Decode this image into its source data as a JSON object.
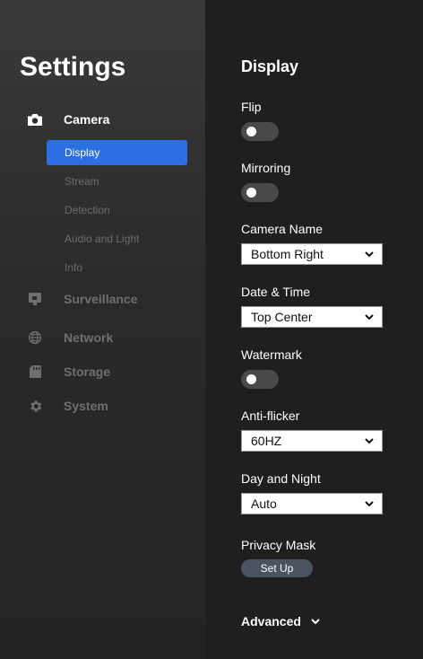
{
  "app": {
    "title": "Settings"
  },
  "sidebar": {
    "camera": {
      "label": "Camera",
      "icon": "camera-icon"
    },
    "sub_items": [
      {
        "label": "Display",
        "active": true
      },
      {
        "label": "Stream",
        "active": false
      },
      {
        "label": "Detection",
        "active": false
      },
      {
        "label": "Audio and Light",
        "active": false
      },
      {
        "label": "Info",
        "active": false
      }
    ],
    "surveillance": {
      "label": "Surveillance",
      "icon": "surveillance-icon"
    },
    "network": {
      "label": "Network",
      "icon": "globe-icon"
    },
    "storage": {
      "label": "Storage",
      "icon": "sd-card-icon"
    },
    "system": {
      "label": "System",
      "icon": "gear-icon"
    }
  },
  "display": {
    "title": "Display",
    "flip": {
      "label": "Flip",
      "on": false
    },
    "mirroring": {
      "label": "Mirroring",
      "on": false
    },
    "camera_name": {
      "label": "Camera Name",
      "value": "Bottom Right"
    },
    "date_time": {
      "label": "Date & Time",
      "value": "Top Center"
    },
    "watermark": {
      "label": "Watermark",
      "on": false
    },
    "anti_flicker": {
      "label": "Anti-flicker",
      "value": "60HZ"
    },
    "day_night": {
      "label": "Day and Night",
      "value": "Auto"
    },
    "privacy_mask": {
      "label": "Privacy Mask",
      "button": "Set Up"
    },
    "advanced": {
      "label": "Advanced"
    }
  },
  "colors": {
    "accent": "#2b6fe3",
    "sidebar_bg": "#2a2a2a",
    "content_bg": "#1f1f1f",
    "toggle_off": "#4a4a4a",
    "button_bg": "#4a5360"
  }
}
